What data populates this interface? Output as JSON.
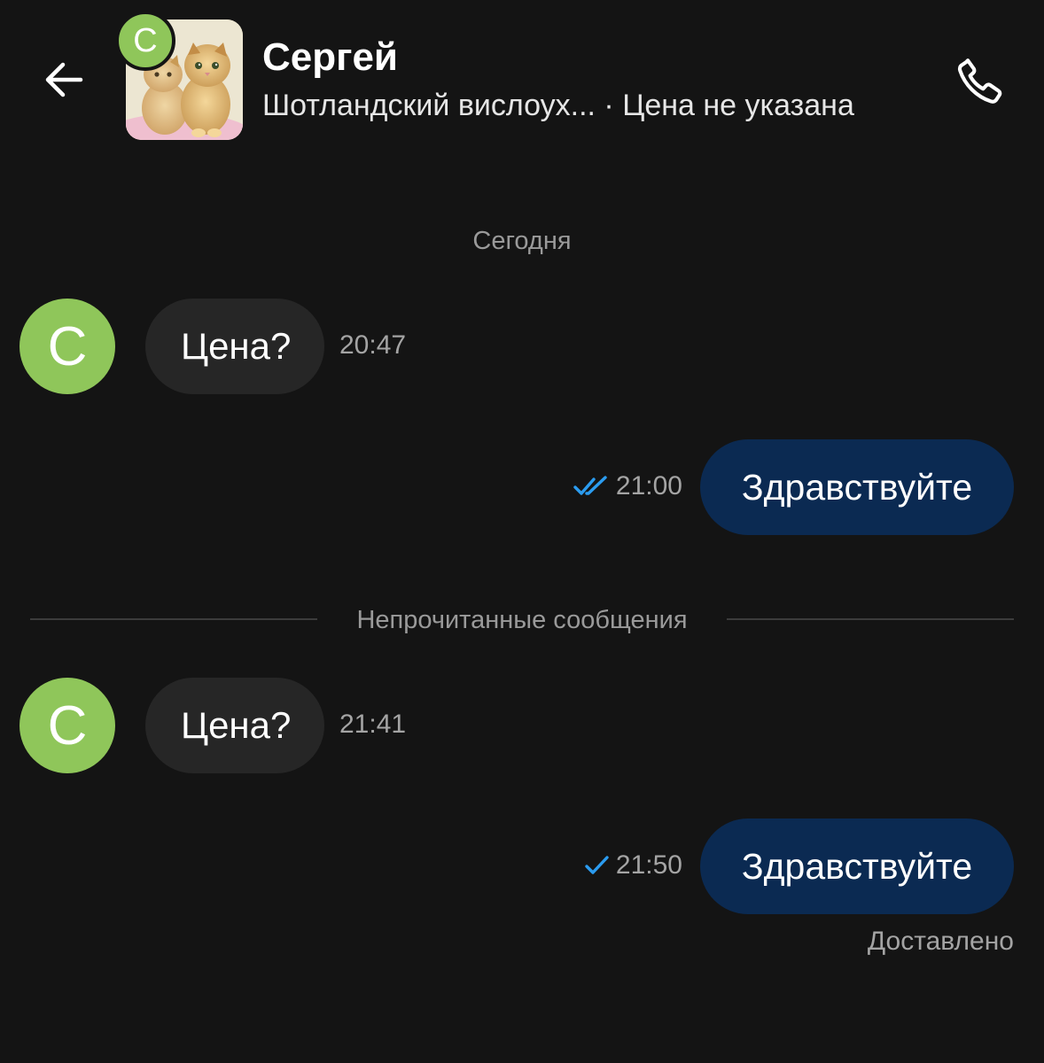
{
  "header": {
    "back_icon": "arrow-left-icon",
    "contact_initial": "С",
    "contact_name": "Сергей",
    "listing_title": "Шотландский вислоух...",
    "separator": "·",
    "listing_price": "Цена не указана",
    "call_icon": "phone-icon"
  },
  "chat": {
    "date_label": "Сегодня",
    "unread_label": "Непрочитанные сообщения",
    "messages": [
      {
        "direction": "incoming",
        "avatar_initial": "С",
        "text": "Цена?",
        "time": "20:47"
      },
      {
        "direction": "outgoing",
        "text": "Здравствуйте",
        "time": "21:00",
        "status_icon": "double-check-icon"
      },
      {
        "direction": "incoming",
        "avatar_initial": "С",
        "text": "Цена?",
        "time": "21:41"
      },
      {
        "direction": "outgoing",
        "text": "Здравствуйте",
        "time": "21:50",
        "status_icon": "single-check-icon"
      }
    ],
    "delivered_label": "Доставлено"
  },
  "colors": {
    "background": "#141414",
    "avatar_green": "#8fc65a",
    "incoming_bubble": "#262626",
    "outgoing_bubble": "#0b2a52",
    "check_blue": "#2b9cf0",
    "muted_text": "#9a9a9a"
  }
}
